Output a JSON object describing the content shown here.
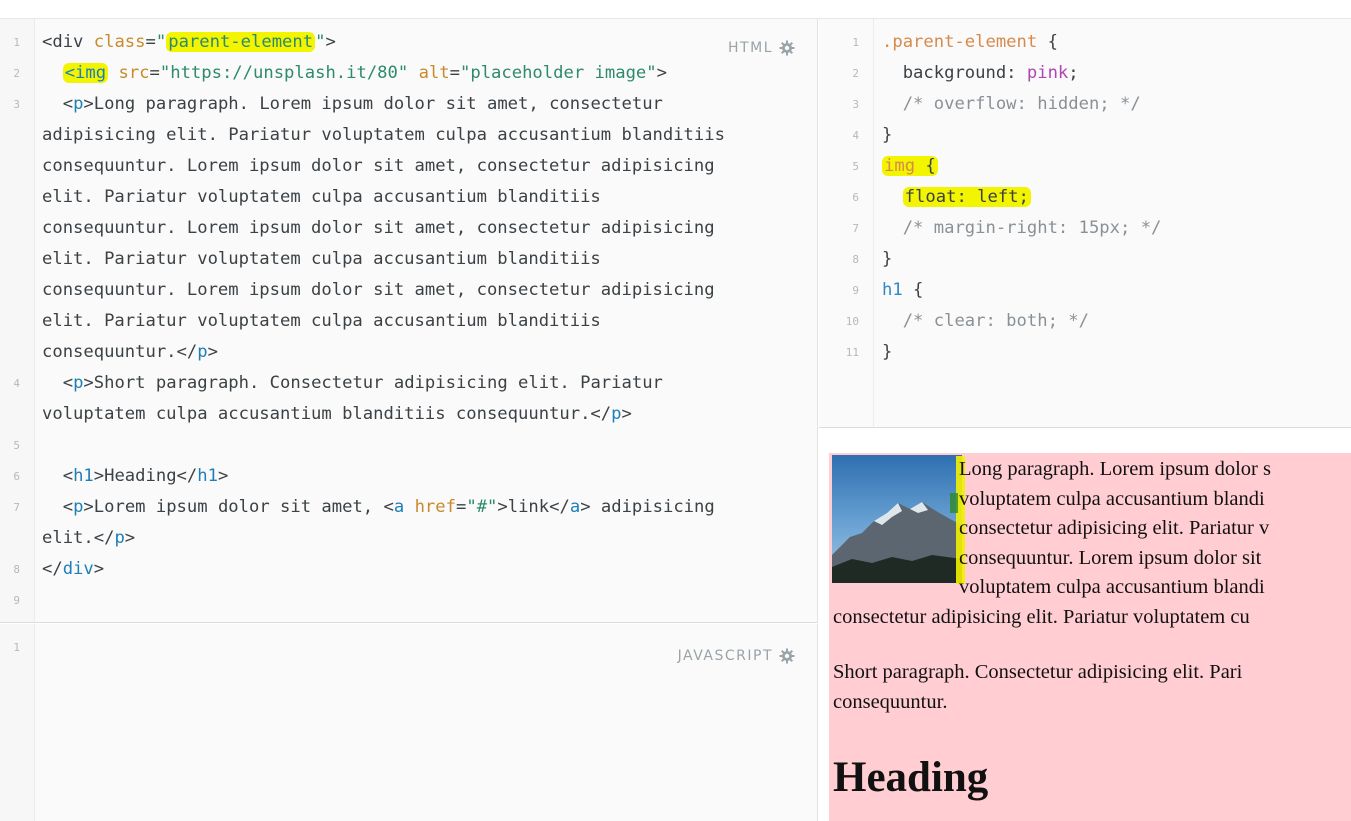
{
  "editor": {
    "html_pane": {
      "label": "HTML",
      "lines": [
        {
          "num": "1",
          "html": "&lt;div <span class='t-attr'>class</span>=<span class='t-str'>\"<span class='hl'>parent-element</span>\"</span>&gt;"
        },
        {
          "num": "2",
          "html": "  <span class='hl'><span class='t-tag'>&lt;img</span></span> <span class='t-attr'>src</span>=<span class='t-str'>\"https://unsplash.it/80\"</span> <span class='t-attr'>alt</span>=<span class='t-str'>\"placeholder image\"</span>&gt;"
        },
        {
          "num": "3",
          "html": "  &lt;<span class='t-tag'>p</span>&gt;Long paragraph. Lorem ipsum dolor sit amet, consectetur\nadipisicing elit. Pariatur voluptatem culpa accusantium blanditiis\nconsequuntur. Lorem ipsum dolor sit amet, consectetur adipisicing\nelit. Pariatur voluptatem culpa accusantium blanditiis\nconsequuntur. Lorem ipsum dolor sit amet, consectetur adipisicing\nelit. Pariatur voluptatem culpa accusantium blanditiis\nconsequuntur. Lorem ipsum dolor sit amet, consectetur adipisicing\nelit. Pariatur voluptatem culpa accusantium blanditiis\nconsequuntur.&lt;/<span class='t-tag'>p</span>&gt;"
        },
        {
          "num": "4",
          "html": "  &lt;<span class='t-tag'>p</span>&gt;Short paragraph. Consectetur adipisicing elit. Pariatur\nvoluptatem culpa accusantium blanditiis consequuntur.&lt;/<span class='t-tag'>p</span>&gt;"
        },
        {
          "num": "5",
          "html": ""
        },
        {
          "num": "6",
          "html": "  &lt;<span class='t-tag'>h1</span>&gt;Heading&lt;/<span class='t-tag'>h1</span>&gt;"
        },
        {
          "num": "7",
          "html": "  &lt;<span class='t-tag'>p</span>&gt;Lorem ipsum dolor sit amet, &lt;<span class='t-tag'>a</span> <span class='t-attr'>href</span>=<span class='t-str'>\"#\"</span>&gt;link&lt;/<span class='t-tag'>a</span>&gt; adipisicing\nelit.&lt;/<span class='t-tag'>p</span>&gt;"
        },
        {
          "num": "8",
          "html": "&lt;/<span class='t-tag'>div</span>&gt;"
        },
        {
          "num": "9",
          "html": ""
        }
      ]
    },
    "css_pane": {
      "lines": [
        {
          "num": "1",
          "html": "<span class='t-sel'>.parent-element</span> {"
        },
        {
          "num": "2",
          "html": "  background: <span class='t-val'>pink</span>;"
        },
        {
          "num": "3",
          "html": "  <span class='t-cmt'>/* overflow: hidden; */</span>"
        },
        {
          "num": "4",
          "html": "}"
        },
        {
          "num": "5",
          "html": "<span class='hl'><span class='t-sel'>img</span> {</span>"
        },
        {
          "num": "6",
          "html": "  <span class='hl'>float: left;</span>"
        },
        {
          "num": "7",
          "html": "  <span class='t-cmt'>/* margin-right: 15px; */</span>"
        },
        {
          "num": "8",
          "html": "}"
        },
        {
          "num": "9",
          "html": "<span class='t-sel2'>h1</span> {"
        },
        {
          "num": "10",
          "html": "  <span class='t-cmt'>/* clear: both; */</span>"
        },
        {
          "num": "11",
          "html": "}"
        }
      ]
    },
    "js_pane": {
      "label": "JAVASCRIPT",
      "lines": [
        {
          "num": "1",
          "html": ""
        }
      ]
    }
  },
  "preview": {
    "background": "#ffcdd2",
    "img_alt": "placeholder image",
    "long_lines": [
      "Long paragraph. Lorem ipsum dolor s",
      "voluptatem culpa accusantium blandi",
      "consectetur adipisicing elit. Pariatur v",
      "consequuntur. Lorem ipsum dolor sit",
      "voluptatem culpa accusantium blandi",
      "consectetur adipisicing elit. Pariatur voluptatem cu"
    ],
    "short_lines": [
      "Short paragraph. Consectetur adipisicing elit. Pari",
      "consequuntur."
    ],
    "heading": "Heading"
  },
  "icons": {
    "settings": "gear-icon"
  },
  "colors": {
    "highlight": "#f3f400",
    "tag": "#1d7fb8",
    "attr": "#c88a2a",
    "string": "#2d8a6a",
    "value": "#b045b5",
    "comment": "#8a9196"
  }
}
